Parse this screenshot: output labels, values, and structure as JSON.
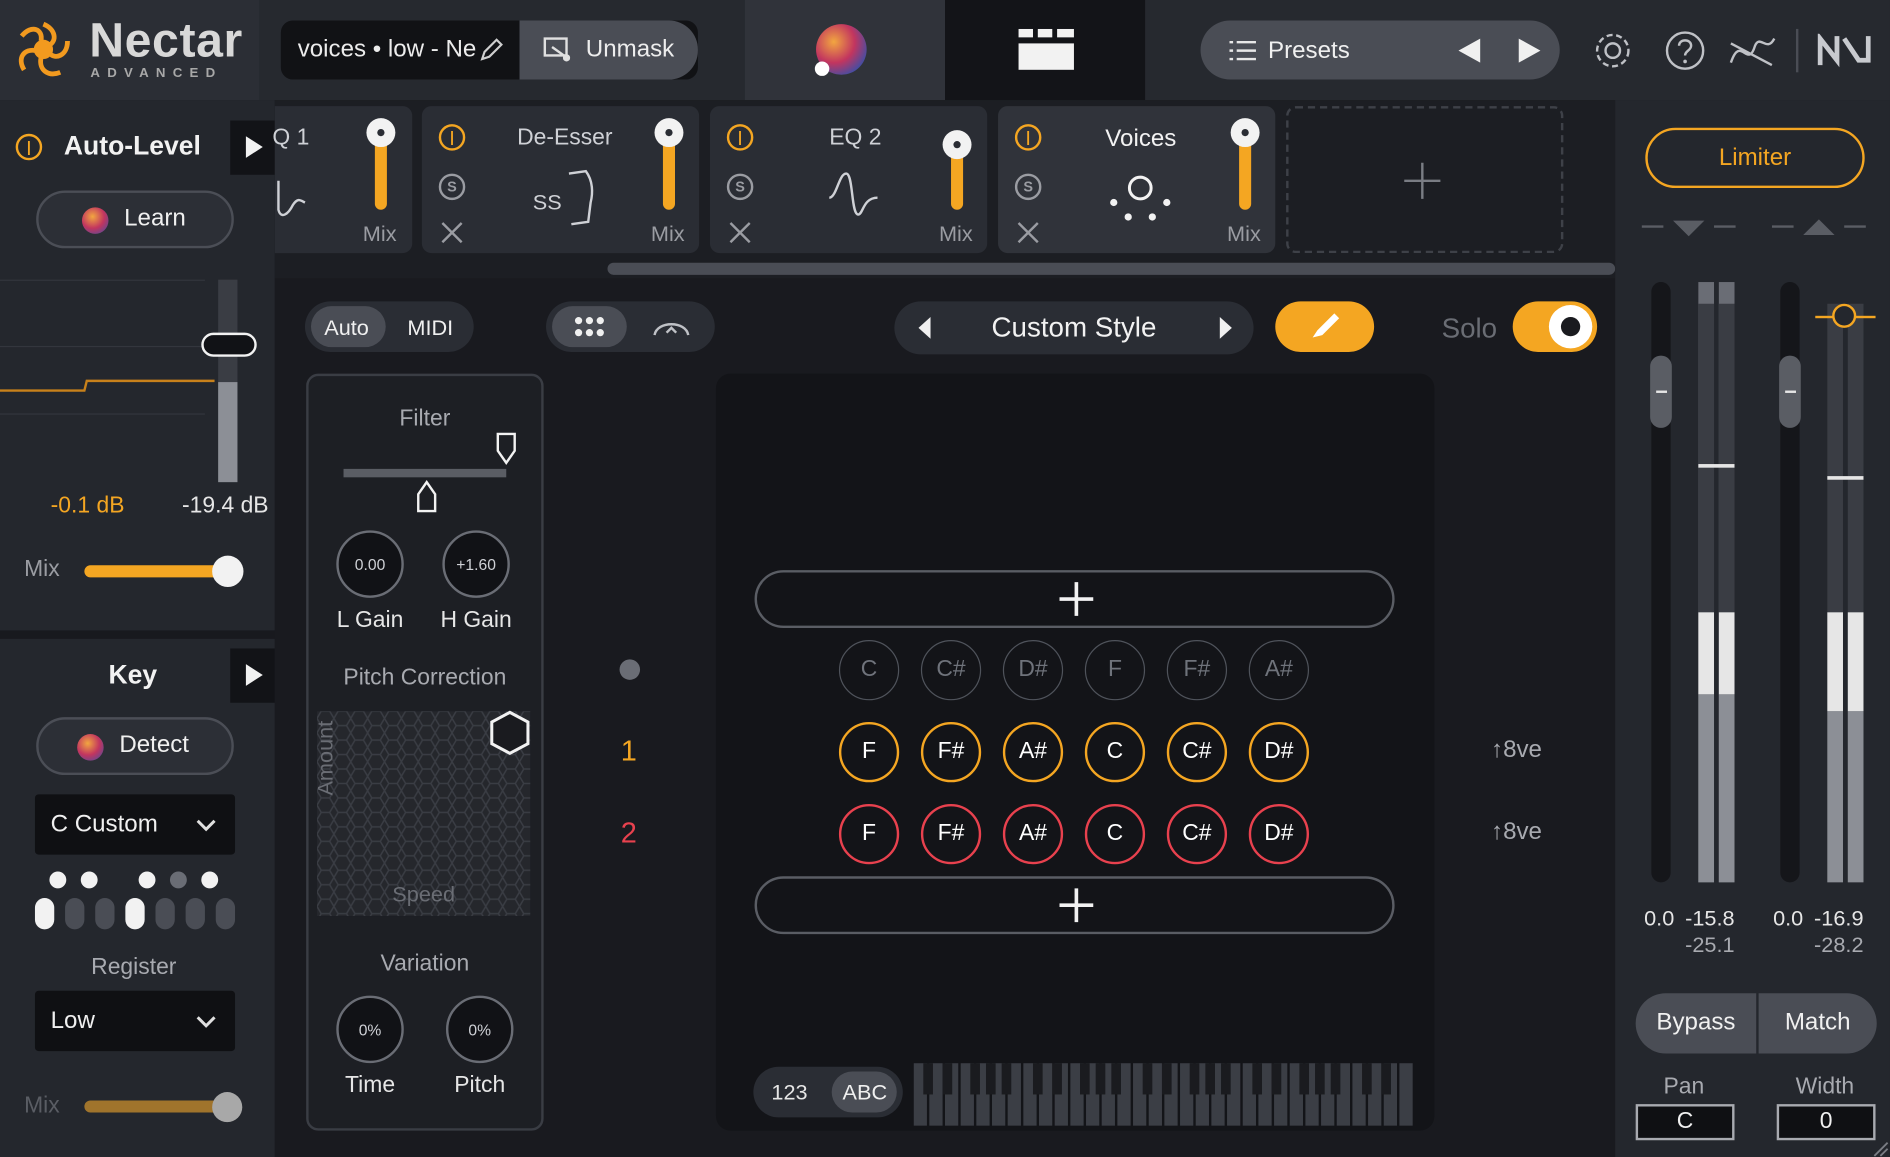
{
  "app": {
    "brand": "Nectar",
    "brand_sub": "ADVANCED",
    "preset_field": "voices • low - Ne",
    "unmask_label": "Unmask",
    "presets_label": "Presets"
  },
  "modules": [
    {
      "name": "Q 1",
      "mix": "Mix"
    },
    {
      "name": "De-Esser",
      "mix": "Mix"
    },
    {
      "name": "EQ 2",
      "mix": "Mix"
    },
    {
      "name": "Voices",
      "mix": "Mix"
    }
  ],
  "auto_level": {
    "title": "Auto-Level",
    "learn_label": "Learn",
    "value_left": "-0.1 dB",
    "value_right": "-19.4 dB",
    "mix_label": "Mix",
    "mix_value": 0.9
  },
  "key": {
    "title": "Key",
    "detect_label": "Detect",
    "scale_value": "C Custom",
    "register_label": "Register",
    "register_value": "Low",
    "mix_label": "Mix"
  },
  "voices_panel": {
    "mode_auto": "Auto",
    "mode_midi": "MIDI",
    "style_name": "Custom Style",
    "solo_label": "Solo",
    "filter_label": "Filter",
    "l_gain_value": "0.00",
    "l_gain_label": "L Gain",
    "h_gain_value": "+1.60",
    "h_gain_label": "H Gain",
    "pitch_correction_label": "Pitch Correction",
    "amount_label": "Amount",
    "speed_label": "Speed",
    "variation_label": "Variation",
    "time_value": "0%",
    "time_label": "Time",
    "pitch_value": "0%",
    "pitch_label": "Pitch",
    "scale_notes": [
      "C",
      "C#",
      "D#",
      "F",
      "F#",
      "A#"
    ],
    "voice_rows": [
      {
        "number": "1",
        "notes": [
          "F",
          "F#",
          "A#",
          "C",
          "C#",
          "D#"
        ],
        "octave": "8ve"
      },
      {
        "number": "2",
        "notes": [
          "F",
          "F#",
          "A#",
          "C",
          "C#",
          "D#"
        ],
        "octave": "8ve"
      }
    ],
    "label_mode_num": "123",
    "label_mode_abc": "ABC"
  },
  "right_panel": {
    "limiter_label": "Limiter",
    "in_peak": "0.0",
    "in_rms": "-15.8",
    "in_rms2": "-25.1",
    "out_peak": "0.0",
    "out_rms": "-16.9",
    "out_rms2": "-28.2",
    "bypass_label": "Bypass",
    "match_label": "Match",
    "pan_label": "Pan",
    "pan_value": "C",
    "width_label": "Width",
    "width_value": "0"
  },
  "colors": {
    "accent": "#f4a622",
    "voice2": "#e8414e",
    "bg": "#18191e",
    "panel": "#2a2d34"
  }
}
